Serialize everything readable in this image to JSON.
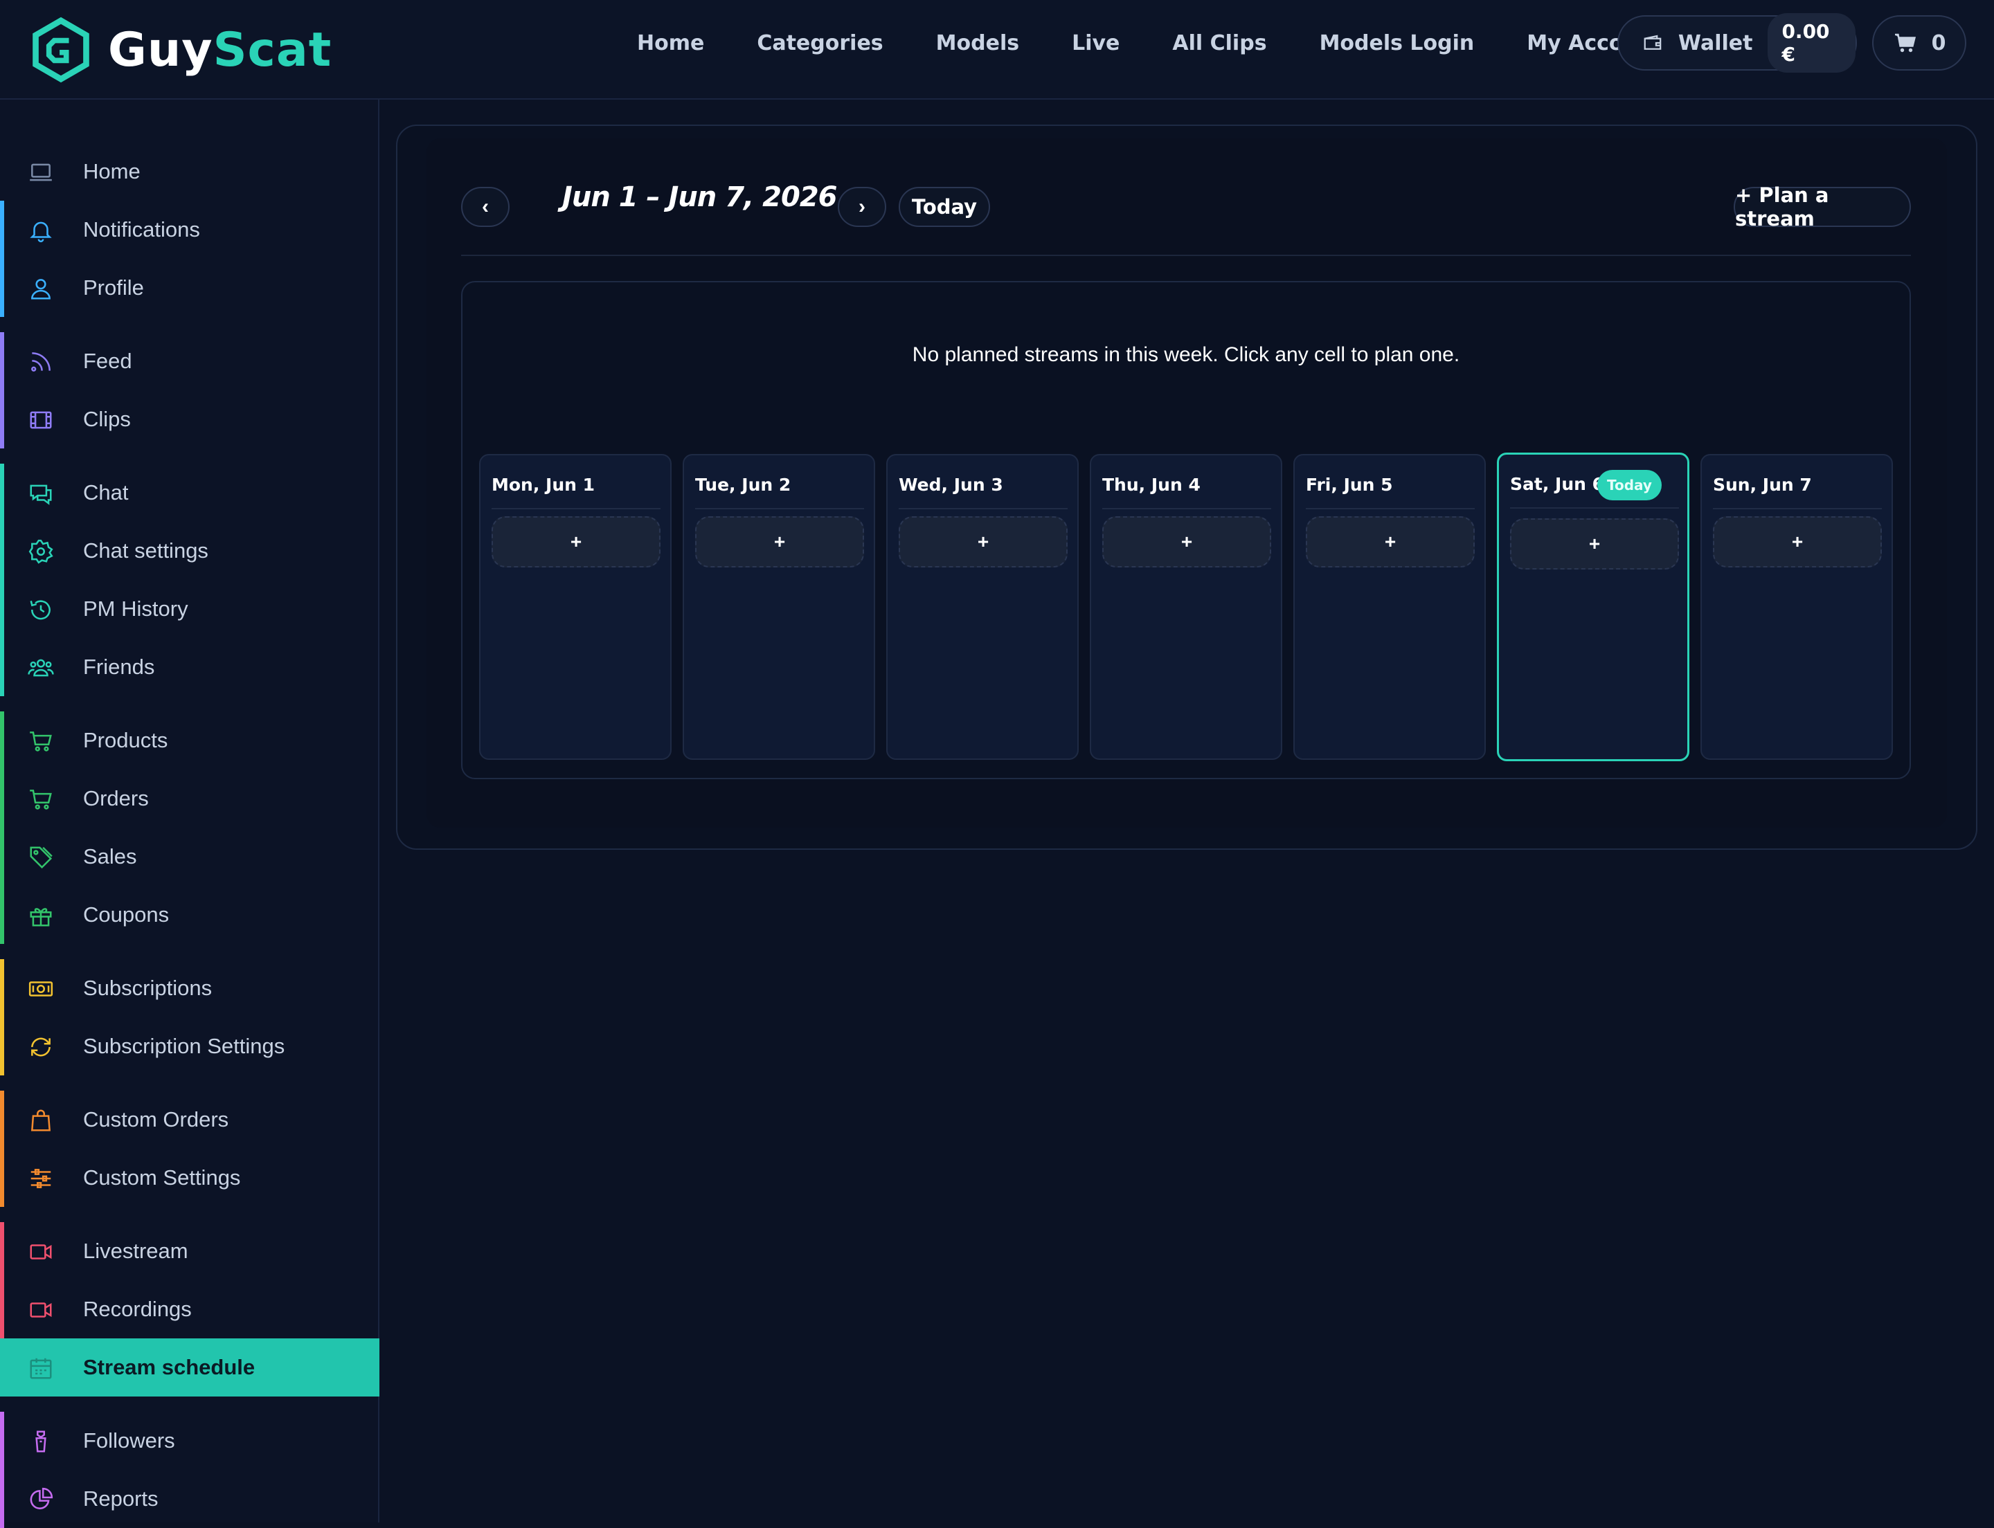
{
  "brand": {
    "name_part1": "Guy",
    "name_part2": "Scat",
    "color": "#2ad3b7"
  },
  "nav": [
    {
      "label": "Home"
    },
    {
      "label": "Categories"
    },
    {
      "label": "Models"
    },
    {
      "label": "Live"
    },
    {
      "label": "All Clips"
    },
    {
      "label": "Models Login"
    },
    {
      "label": "My Account"
    }
  ],
  "wallet": {
    "label": "Wallet",
    "amount": "0.00 €",
    "icon": "wallet-icon"
  },
  "cart": {
    "count": "0",
    "icon": "cart-icon"
  },
  "sidebar": {
    "items": [
      {
        "label": "Home",
        "icon": "laptop-icon",
        "color": "#7a8aa6"
      },
      {
        "label": "Notifications",
        "icon": "bell-icon",
        "color": "#3ab0ff"
      },
      {
        "label": "Profile",
        "icon": "user-icon",
        "color": "#3ab0ff"
      },
      {
        "label": "Feed",
        "icon": "rss-icon",
        "color": "#8f7cf5"
      },
      {
        "label": "Clips",
        "icon": "film-icon",
        "color": "#8f7cf5"
      },
      {
        "label": "Chat",
        "icon": "chat-icon",
        "color": "#2ad3b7"
      },
      {
        "label": "Chat settings",
        "icon": "gear-icon",
        "color": "#2ad3b7"
      },
      {
        "label": "PM History",
        "icon": "history-icon",
        "color": "#2ad3b7"
      },
      {
        "label": "Friends",
        "icon": "users-icon",
        "color": "#2ad3b7"
      },
      {
        "label": "Products",
        "icon": "cart-icon",
        "color": "#33c46b"
      },
      {
        "label": "Orders",
        "icon": "cart-icon",
        "color": "#33c46b"
      },
      {
        "label": "Sales",
        "icon": "tag-icon",
        "color": "#33c46b"
      },
      {
        "label": "Coupons",
        "icon": "gift-icon",
        "color": "#33c46b"
      },
      {
        "label": "Subscriptions",
        "icon": "money-icon",
        "color": "#f2c230"
      },
      {
        "label": "Subscription Settings",
        "icon": "refresh-icon",
        "color": "#f2c230"
      },
      {
        "label": "Custom Orders",
        "icon": "bag-icon",
        "color": "#f28a2e"
      },
      {
        "label": "Custom Settings",
        "icon": "sliders-icon",
        "color": "#f28a2e"
      },
      {
        "label": "Livestream",
        "icon": "video-icon",
        "color": "#f0506e"
      },
      {
        "label": "Recordings",
        "icon": "video-icon",
        "color": "#f0506e"
      },
      {
        "label": "Stream schedule",
        "icon": "calendar-icon",
        "color": "#22c5ad",
        "active": true
      },
      {
        "label": "Followers",
        "icon": "shirt-icon",
        "color": "#c56cf0"
      },
      {
        "label": "Reports",
        "icon": "pie-icon",
        "color": "#c56cf0"
      }
    ]
  },
  "schedule": {
    "prev_label": "‹",
    "next_label": "›",
    "range": "Jun 1 – Jun 7, 2026",
    "today_label": "Today",
    "plan_label": "+ Plan a stream",
    "empty_message": "No planned streams in this week. Click any cell to plan one.",
    "add_label": "+",
    "today_badge": "Today",
    "days": [
      {
        "label": "Mon, Jun 1"
      },
      {
        "label": "Tue, Jun 2"
      },
      {
        "label": "Wed, Jun 3"
      },
      {
        "label": "Thu, Jun 4"
      },
      {
        "label": "Fri, Jun 5"
      },
      {
        "label": "Sat, Jun 6",
        "today": true
      },
      {
        "label": "Sun, Jun 7"
      }
    ]
  }
}
